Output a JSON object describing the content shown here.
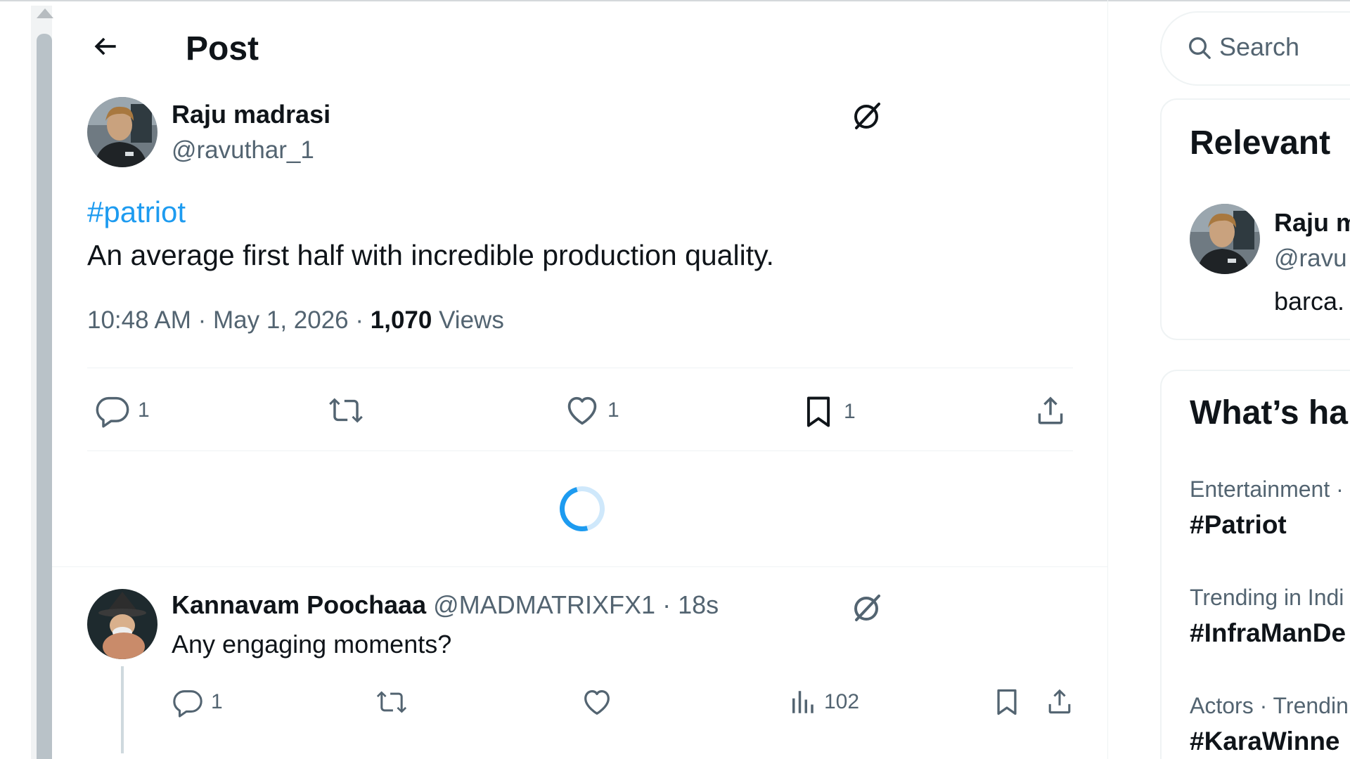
{
  "header": {
    "title": "Post",
    "back_label": "Back"
  },
  "post": {
    "author_name": "Raju madrasi",
    "author_handle": "@ravuthar_1",
    "hashtag": "#patriot",
    "text": "An average first half with incredible production quality.",
    "time": "10:48 AM",
    "date": "May 1, 2026",
    "separator": "·",
    "views_count": "1,070",
    "views_label": "Views",
    "actions": {
      "replies": "1",
      "reposts": "",
      "likes": "1",
      "bookmarks": "1"
    }
  },
  "loading": {
    "state": "spinner"
  },
  "reply": {
    "author_name": "Kannavam Poochaaa",
    "author_handle": "@MADMATRIXFX1",
    "separator": "·",
    "time": "18s",
    "text": "Any engaging moments?",
    "actions": {
      "replies": "1",
      "reposts": "",
      "likes": "",
      "views": "102"
    }
  },
  "sidebar": {
    "search": {
      "placeholder": "Search"
    },
    "relevant": {
      "title": "Relevant",
      "person": {
        "name": "Raju m",
        "handle": "@ravu",
        "bio": "barca."
      }
    },
    "trends": {
      "title": "What’s ha",
      "items": [
        {
          "category": "Entertainment ·",
          "tag": "#Patriot"
        },
        {
          "category": "Trending in Indi",
          "tag": "#InfraManDe"
        },
        {
          "category": "Actors · Trendin",
          "tag": "#KaraWinne"
        }
      ]
    }
  },
  "colors": {
    "accent": "#1d9bf0",
    "text": "#0f1419",
    "muted": "#536471",
    "border": "#eff3f4"
  }
}
